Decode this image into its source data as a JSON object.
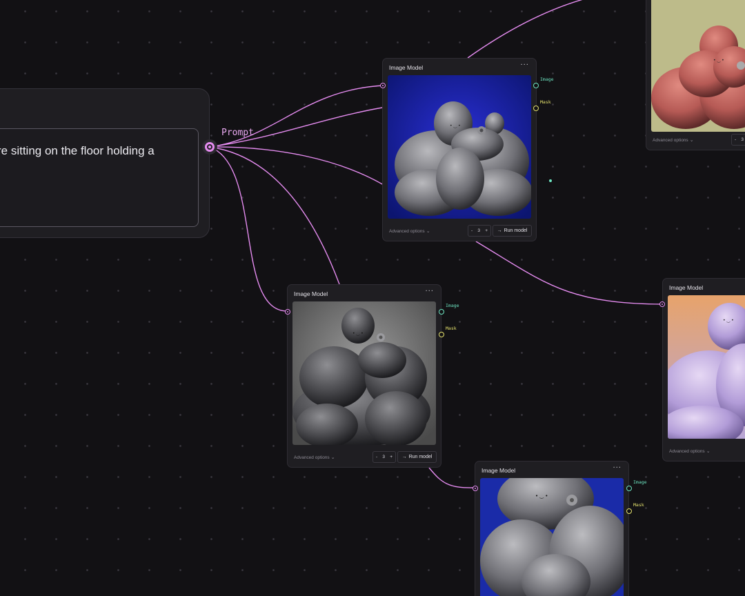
{
  "prompt_node": {
    "text": "re sitting on the floor holding a",
    "port_label": "Prompt"
  },
  "node_common": {
    "title": "Image Model",
    "menu": "···",
    "advanced": "Advanced options",
    "run": "Run model",
    "image_port": "Image",
    "mask_port": "Mask",
    "count": "3",
    "minus": "-",
    "plus": "+"
  },
  "colors": {
    "background": "#121114",
    "wire": "#e58cf0",
    "image_port": "#6ee6c2",
    "mask_port": "#e6e36e"
  },
  "icons": [
    "ellipsis-icon",
    "chevron-down-icon",
    "arrow-right-icon",
    "input-port-icon",
    "output-port-icon"
  ]
}
